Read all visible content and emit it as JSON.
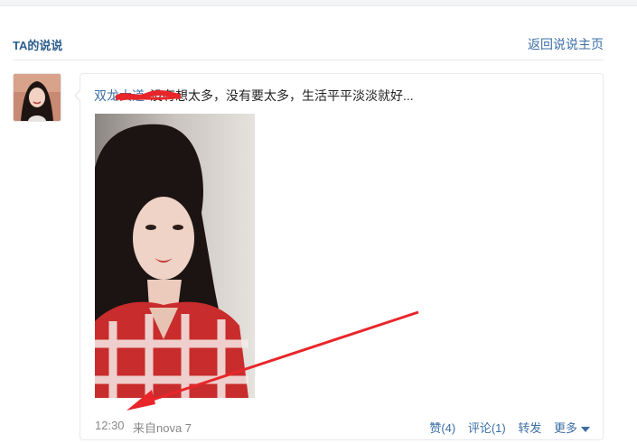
{
  "header": {
    "title": "TA的说说",
    "home_link": "返回说说主页"
  },
  "post": {
    "author": "双龙大道",
    "text": "没有想太多，没有要太多，生活平平淡淡就好...",
    "time": "12:30",
    "source": "来自nova 7"
  },
  "actions": {
    "like": "赞(4)",
    "comment": "评论(1)",
    "forward": "转发",
    "more": "更多"
  },
  "colors": {
    "link": "#3b6ea5",
    "title": "#2b5d8c",
    "annotation": "#e8262a"
  },
  "icons": {
    "more": "chevron-down-icon"
  }
}
